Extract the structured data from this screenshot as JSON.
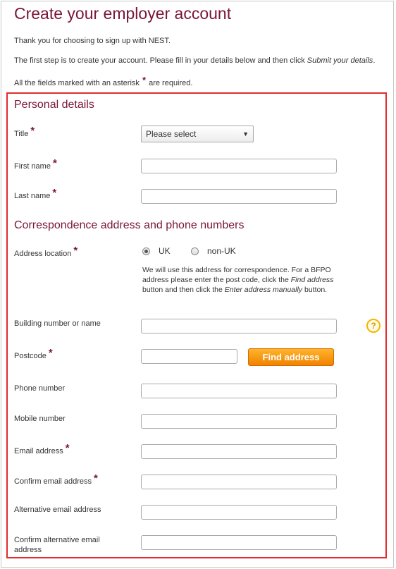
{
  "page": {
    "title": "Create your employer account",
    "intro_thanks": "Thank you for choosing to sign up with NEST.",
    "intro_step_prefix": "The first step is to create your account. Please fill in your details below and then click ",
    "intro_step_action": "Submit your details",
    "intro_step_suffix": ".",
    "required_prefix": "All the fields marked with an asterisk ",
    "required_suffix": " are required.",
    "asterisk": "*"
  },
  "personal_details": {
    "heading": "Personal details",
    "title_label": "Title",
    "title_select_value": "Please select",
    "first_name_label": "First name",
    "first_name_value": "",
    "last_name_label": "Last name",
    "last_name_value": ""
  },
  "correspondence": {
    "heading": "Correspondence address and phone numbers",
    "address_location_label": "Address location",
    "option_uk": "UK",
    "option_non_uk": "non-UK",
    "selected_option": "UK",
    "help_part1": "We will use this address for correspondence. For a BFPO address please enter the post code, click the ",
    "help_find": "Find address",
    "help_part2": " button and then click the ",
    "help_enter": "Enter address manually",
    "help_part3": " button.",
    "building_label": "Building number or name",
    "building_value": "",
    "help_icon_glyph": "?",
    "postcode_label": "Postcode",
    "postcode_value": "",
    "find_address_label": "Find address",
    "phone_label": "Phone number",
    "phone_value": "",
    "mobile_label": "Mobile number",
    "mobile_value": "",
    "email_label": "Email address",
    "email_value": "",
    "confirm_email_label": "Confirm email address",
    "confirm_email_value": "",
    "alt_email_label": "Alternative email address",
    "alt_email_value": "",
    "confirm_alt_email_label": "Confirm alternative email address",
    "confirm_alt_email_value": ""
  },
  "colors": {
    "brand": "#7a1538",
    "highlight_border": "#e32b2b",
    "button": "#f08200"
  },
  "icons": {
    "select_chevron": "chevron-down-icon",
    "help": "question-icon"
  }
}
